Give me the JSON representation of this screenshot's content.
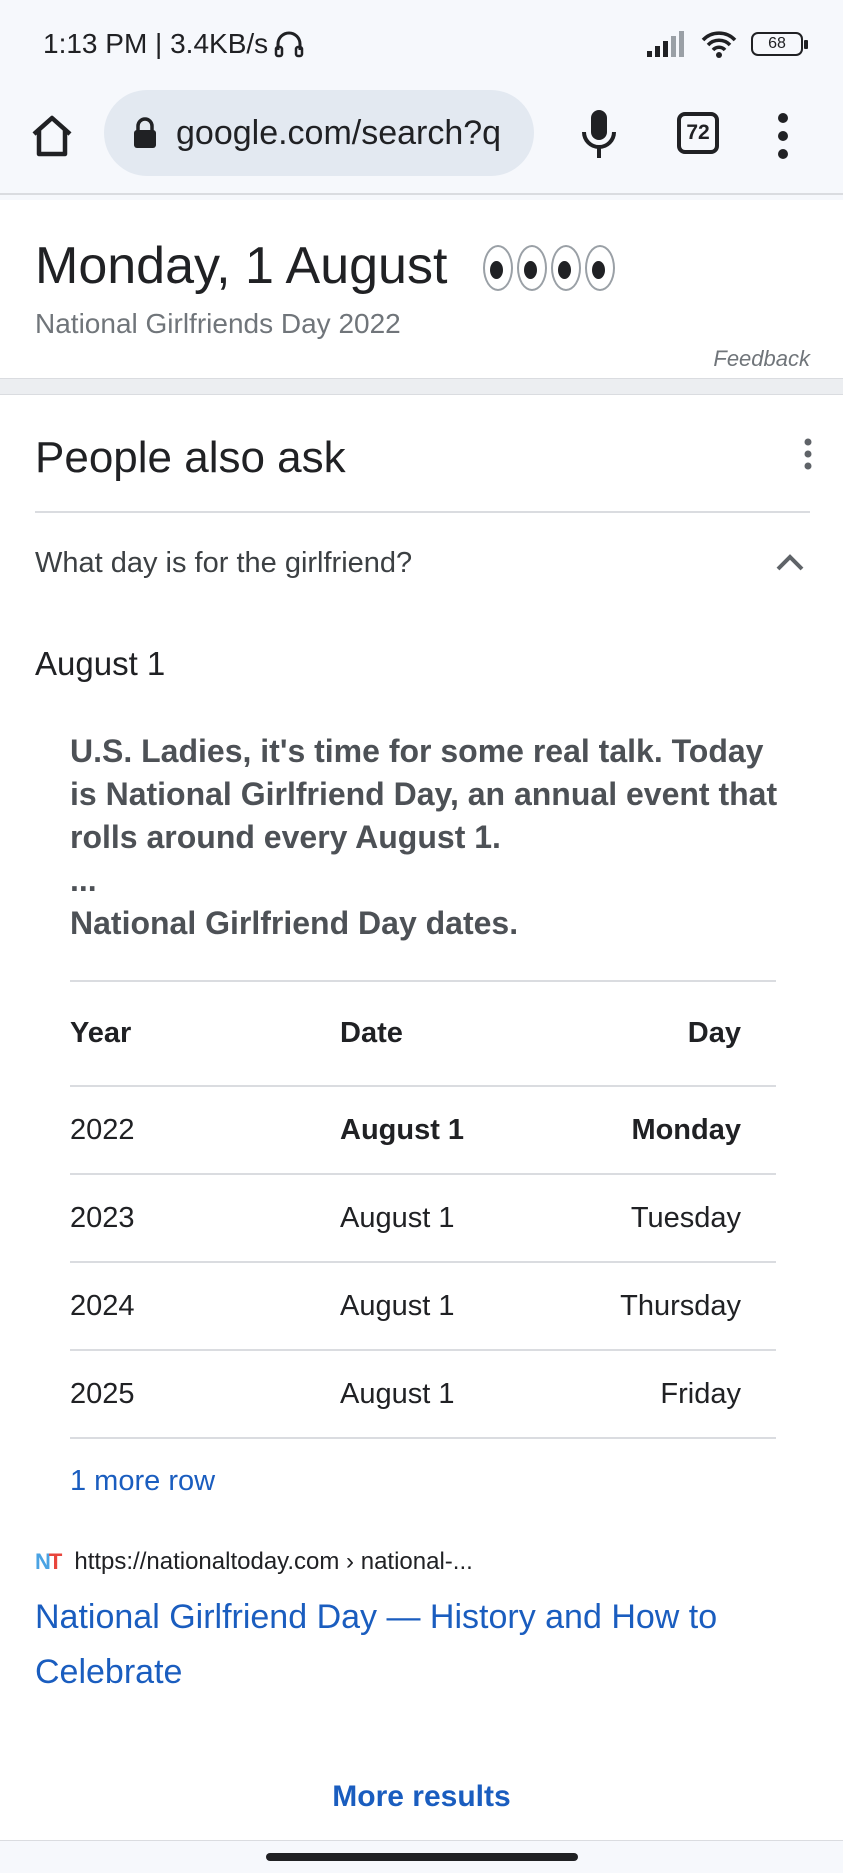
{
  "status_bar": {
    "time_speed": "1:13 PM | 3.4KB/s",
    "battery": "68"
  },
  "browser": {
    "url": "google.com/search?q",
    "tab_count": "72"
  },
  "date_card": {
    "title": "Monday, 1 August",
    "subtitle": "National Girlfriends Day 2022",
    "feedback": "Feedback"
  },
  "people_also_ask": {
    "title": "People also ask",
    "question": "What day is for the girlfriend?",
    "answer_heading": "August 1",
    "snippet_lines": [
      "U.S. Ladies, it's time for some real talk. Today is National Girlfriend Day, an annual event that rolls around every August 1.",
      "...",
      "National Girlfriend Day dates."
    ],
    "table": {
      "headers": [
        "Year",
        "Date",
        "Day"
      ],
      "rows": [
        [
          "2022",
          "August 1",
          "Monday"
        ],
        [
          "2023",
          "August 1",
          "Tuesday"
        ],
        [
          "2024",
          "August 1",
          "Thursday"
        ],
        [
          "2025",
          "August 1",
          "Friday"
        ]
      ]
    },
    "more_row": "1 more row",
    "source_url": "https://nationaltoday.com › national-...",
    "result_title": "National Girlfriend Day — History and How to Celebrate",
    "more_results": "More results"
  },
  "icons": {
    "favicon_text_n": "N",
    "favicon_text_t": "T"
  }
}
